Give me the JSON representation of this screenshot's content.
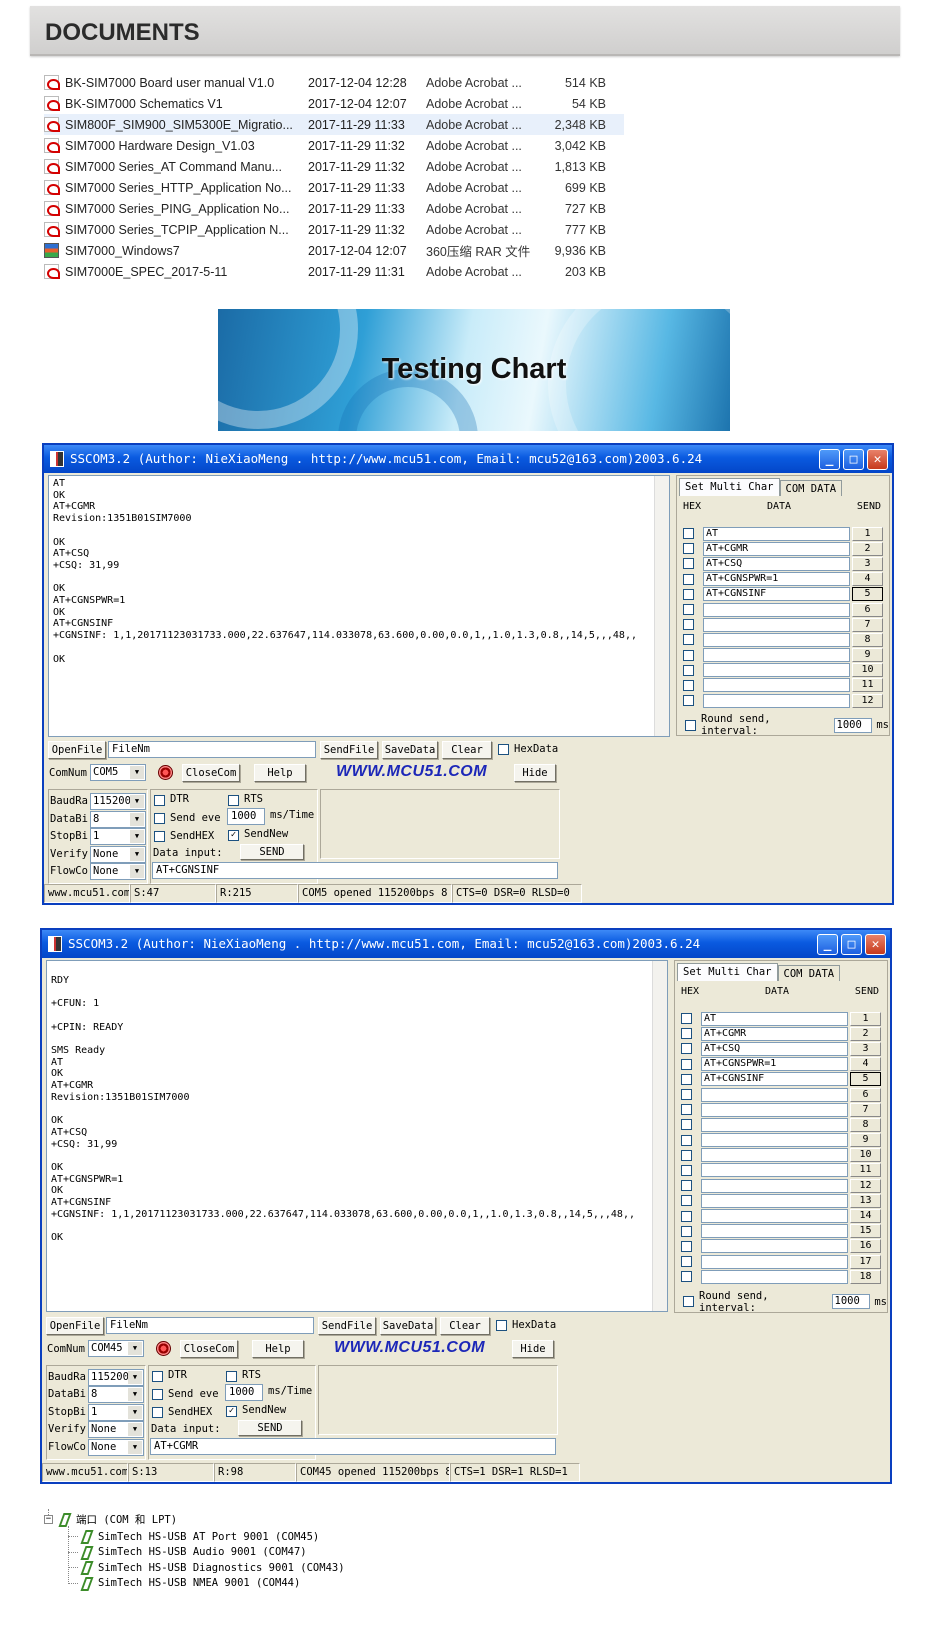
{
  "header": {
    "title": "DOCUMENTS"
  },
  "files": [
    {
      "name": "BK-SIM7000 Board user manual V1.0",
      "date": "2017-12-04 12:28",
      "type": "Adobe Acrobat ...",
      "size": "514 KB",
      "icon": "pdf-icon"
    },
    {
      "name": "BK-SIM7000 Schematics V1",
      "date": "2017-12-04 12:07",
      "type": "Adobe Acrobat ...",
      "size": "54 KB",
      "icon": "pdf-icon"
    },
    {
      "name": "SIM800F_SIM900_SIM5300E_Migratio...",
      "date": "2017-11-29 11:33",
      "type": "Adobe Acrobat ...",
      "size": "2,348 KB",
      "icon": "pdf-icon"
    },
    {
      "name": "SIM7000 Hardware Design_V1.03",
      "date": "2017-11-29 11:32",
      "type": "Adobe Acrobat ...",
      "size": "3,042 KB",
      "icon": "pdf-icon"
    },
    {
      "name": "SIM7000 Series_AT Command Manu...",
      "date": "2017-11-29 11:32",
      "type": "Adobe Acrobat ...",
      "size": "1,813 KB",
      "icon": "pdf-icon"
    },
    {
      "name": "SIM7000 Series_HTTP_Application No...",
      "date": "2017-11-29 11:33",
      "type": "Adobe Acrobat ...",
      "size": "699 KB",
      "icon": "pdf-icon"
    },
    {
      "name": "SIM7000 Series_PING_Application No...",
      "date": "2017-11-29 11:33",
      "type": "Adobe Acrobat ...",
      "size": "727 KB",
      "icon": "pdf-icon"
    },
    {
      "name": "SIM7000 Series_TCPIP_Application N...",
      "date": "2017-11-29 11:32",
      "type": "Adobe Acrobat ...",
      "size": "777 KB",
      "icon": "pdf-icon"
    },
    {
      "name": "SIM7000_Windows7",
      "date": "2017-12-04 12:07",
      "type": "360压缩 RAR 文件",
      "size": "9,936 KB",
      "icon": "rar-icon"
    },
    {
      "name": "SIM7000E_SPEC_2017-5-11",
      "date": "2017-11-29 11:31",
      "type": "Adobe Acrobat ...",
      "size": "203 KB",
      "icon": "pdf-icon"
    }
  ],
  "banner": {
    "text": "Testing Chart"
  },
  "windows": [
    {
      "title": "SSCOM3.2 (Author: NieXiaoMeng . http://www.mcu51.com, Email: mcu52@163.com)2003.6.24",
      "recv": "AT\nOK\nAT+CGMR\nRevision:1351B01SIM7000\n\nOK\nAT+CSQ\n+CSQ: 31,99\n\nOK\nAT+CGNSPWR=1\nOK\nAT+CGNSINF\n+CGNSINF: 1,1,20171123031733.000,22.637647,114.033078,63.600,0.00,0.0,1,,1.0,1.3,0.8,,14,5,,,48,,\n\nOK",
      "tab_multi": "Set Multi Char",
      "tab_com": "COM DATA",
      "col_hex": "HEX",
      "col_data": "DATA",
      "col_send": "SEND",
      "multi": [
        {
          "data": "AT",
          "n": "1"
        },
        {
          "data": "AT+CGMR",
          "n": "2"
        },
        {
          "data": "AT+CSQ",
          "n": "3"
        },
        {
          "data": "AT+CGNSPWR=1",
          "n": "4"
        },
        {
          "data": "AT+CGNSINF",
          "n": "5"
        },
        {
          "data": "",
          "n": "6"
        },
        {
          "data": "",
          "n": "7"
        },
        {
          "data": "",
          "n": "8"
        },
        {
          "data": "",
          "n": "9"
        },
        {
          "data": "",
          "n": "10"
        },
        {
          "data": "",
          "n": "11"
        },
        {
          "data": "",
          "n": "12"
        }
      ],
      "round_label": "Round send, interval:",
      "round_value": "1000",
      "round_unit": "ms",
      "openfile": "OpenFile",
      "filename": "FileNm",
      "sendfile": "SendFile",
      "savedata": "SaveData",
      "clear": "Clear",
      "hexdata": "HexData",
      "comnum_label": "ComNum",
      "comnum": "COM5",
      "closecom": "CloseCom",
      "help": "Help",
      "www": "WWW.MCU51.COM",
      "hide": "Hide",
      "baud_label": "BaudRa",
      "baud": "115200",
      "databits_label": "DataBi",
      "databits": "8",
      "stopbits_label": "StopBi",
      "stopbits": "1",
      "verify_label": "Verify",
      "verify": "None",
      "flow_label": "FlowCo",
      "flow": "None",
      "dtr": "DTR",
      "rts": "RTS",
      "send_every": "Send eve",
      "interval": "1000",
      "interval_unit": "ms/Time",
      "sendhex": "SendHEX",
      "sendnew": "SendNew",
      "data_input_label": "Data input:",
      "send": "SEND",
      "data_input": "AT+CGNSINF",
      "status": [
        "www.mcu51.com",
        "S:47",
        "R:215",
        "COM5 opened 115200bps  8",
        "CTS=0 DSR=0 RLSD=0"
      ]
    },
    {
      "title": "SSCOM3.2 (Author: NieXiaoMeng . http://www.mcu51.com, Email: mcu52@163.com)2003.6.24",
      "recv": "\nRDY\n\n+CFUN: 1\n\n+CPIN: READY\n\nSMS Ready\nAT\nOK\nAT+CGMR\nRevision:1351B01SIM7000\n\nOK\nAT+CSQ\n+CSQ: 31,99\n\nOK\nAT+CGNSPWR=1\nOK\nAT+CGNSINF\n+CGNSINF: 1,1,20171123031733.000,22.637647,114.033078,63.600,0.00,0.0,1,,1.0,1.3,0.8,,14,5,,,48,,\n\nOK",
      "tab_multi": "Set Multi Char",
      "tab_com": "COM DATA",
      "col_hex": "HEX",
      "col_data": "DATA",
      "col_send": "SEND",
      "multi": [
        {
          "data": "AT",
          "n": "1"
        },
        {
          "data": "AT+CGMR",
          "n": "2"
        },
        {
          "data": "AT+CSQ",
          "n": "3"
        },
        {
          "data": "AT+CGNSPWR=1",
          "n": "4"
        },
        {
          "data": "AT+CGNSINF",
          "n": "5"
        },
        {
          "data": "",
          "n": "6"
        },
        {
          "data": "",
          "n": "7"
        },
        {
          "data": "",
          "n": "8"
        },
        {
          "data": "",
          "n": "9"
        },
        {
          "data": "",
          "n": "10"
        },
        {
          "data": "",
          "n": "11"
        },
        {
          "data": "",
          "n": "12"
        },
        {
          "data": "",
          "n": "13"
        },
        {
          "data": "",
          "n": "14"
        },
        {
          "data": "",
          "n": "15"
        },
        {
          "data": "",
          "n": "16"
        },
        {
          "data": "",
          "n": "17"
        },
        {
          "data": "",
          "n": "18"
        }
      ],
      "round_label": "Round send, interval:",
      "round_value": "1000",
      "round_unit": "ms",
      "openfile": "OpenFile",
      "filename": "FileNm",
      "sendfile": "SendFile",
      "savedata": "SaveData",
      "clear": "Clear",
      "hexdata": "HexData",
      "comnum_label": "ComNum",
      "comnum": "COM45",
      "closecom": "CloseCom",
      "help": "Help",
      "www": "WWW.MCU51.COM",
      "hide": "Hide",
      "baud_label": "BaudRa",
      "baud": "115200",
      "databits_label": "DataBi",
      "databits": "8",
      "stopbits_label": "StopBi",
      "stopbits": "1",
      "verify_label": "Verify",
      "verify": "None",
      "flow_label": "FlowCo",
      "flow": "None",
      "dtr": "DTR",
      "rts": "RTS",
      "send_every": "Send eve",
      "interval": "1000",
      "interval_unit": "ms/Time",
      "sendhex": "SendHEX",
      "sendnew": "SendNew",
      "data_input_label": "Data input:",
      "send": "SEND",
      "data_input": "AT+CGMR",
      "status": [
        "www.mcu51.com",
        "S:13",
        "R:98",
        "COM45 opened 115200bps  8",
        "CTS=1 DSR=1 RLSD=1"
      ]
    }
  ],
  "device_tree": {
    "root": "端口 (COM 和 LPT)",
    "children": [
      "SimTech HS-USB AT Port 9001 (COM45)",
      "SimTech HS-USB Audio 9001 (COM47)",
      "SimTech HS-USB Diagnostics 9001 (COM43)",
      "SimTech HS-USB NMEA 9001 (COM44)"
    ]
  }
}
